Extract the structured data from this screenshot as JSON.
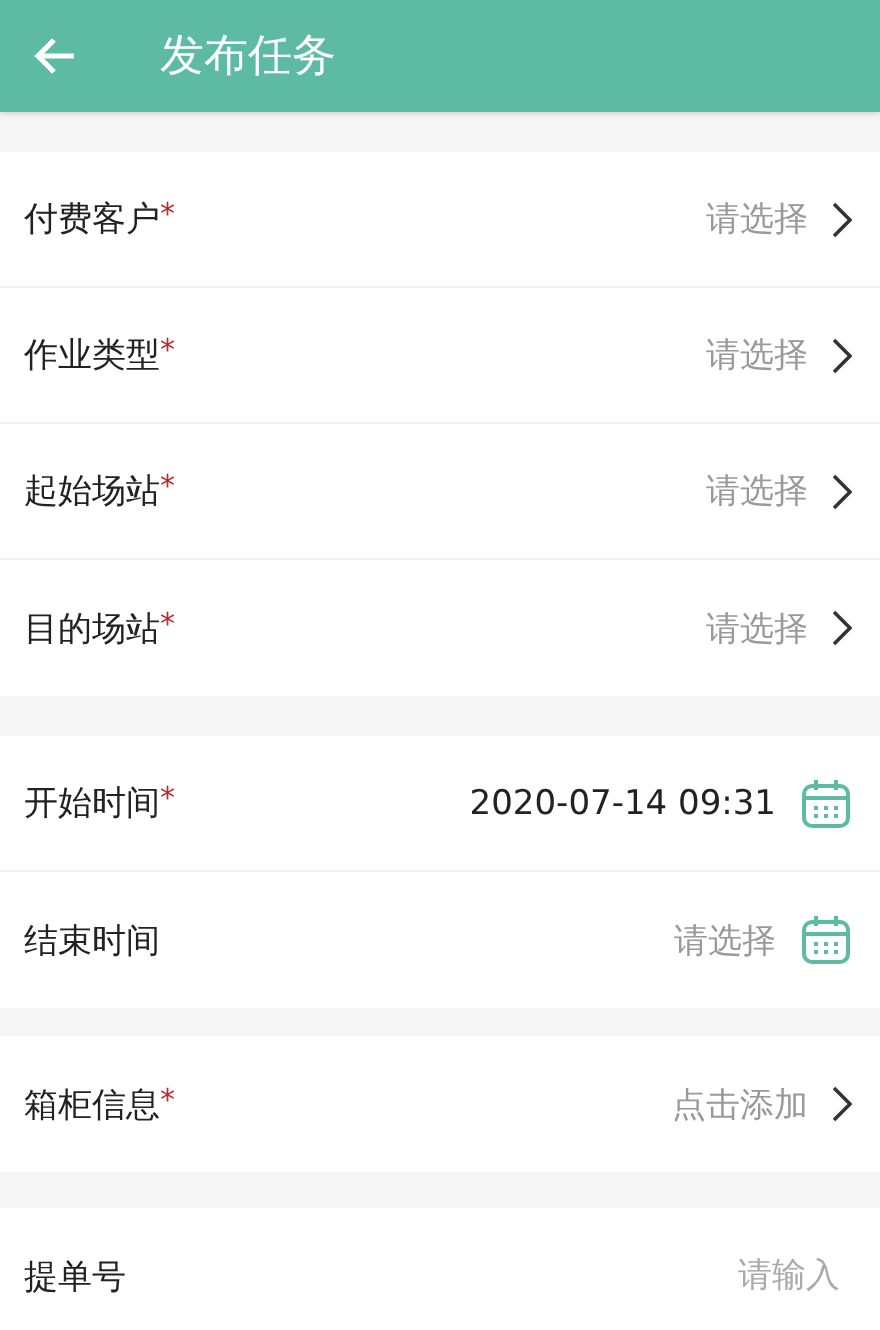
{
  "header": {
    "title": "发布任务"
  },
  "sections": [
    {
      "rows": [
        {
          "kind": "select",
          "label": "付费客户",
          "required_mark": "*",
          "placeholder": "请选择"
        },
        {
          "kind": "select",
          "label": "作业类型",
          "required_mark": "*",
          "placeholder": "请选择"
        },
        {
          "kind": "select",
          "label": "起始场站",
          "required_mark": "*",
          "placeholder": "请选择"
        },
        {
          "kind": "select",
          "label": "目的场站",
          "required_mark": "*",
          "placeholder": "请选择"
        }
      ]
    },
    {
      "rows": [
        {
          "kind": "date",
          "label": "开始时间",
          "required_mark": "*",
          "value": "2020-07-14 09:31"
        },
        {
          "kind": "date",
          "label": "结束时间",
          "placeholder": "请选择"
        }
      ]
    },
    {
      "rows": [
        {
          "kind": "select",
          "label": "箱柜信息",
          "required_mark": "*",
          "placeholder": "点击添加"
        }
      ]
    },
    {
      "rows": [
        {
          "kind": "input",
          "label": "提单号",
          "placeholder": "请输入"
        }
      ]
    }
  ]
}
